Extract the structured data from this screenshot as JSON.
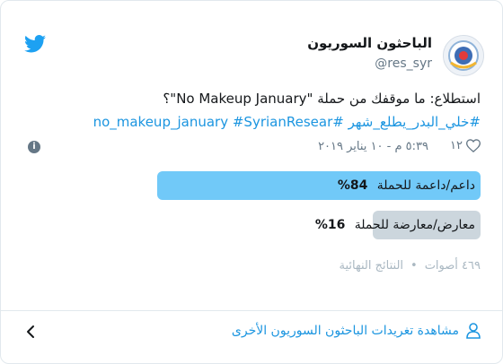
{
  "tweet": {
    "display_name": "الباحثون السوريون",
    "handle": "@res_syr",
    "text_line1": "استطلاع: ما موقفك من حملة \"No Makeup January\"؟",
    "hashtags": [
      "#خلي_البدر_يطلع_شهر",
      "#no_makeup_january",
      "#SyrianResear"
    ],
    "like_count": "١٢",
    "timestamp": "٥:٣٩ م - ١٠ يناير ٢٠١٩",
    "icons": {
      "logo": "twitter-bird-icon",
      "like": "heart-icon",
      "info": "info-icon",
      "avatar": "account-avatar"
    }
  },
  "poll": {
    "options": [
      {
        "label": "داعم/داعمة للحملة",
        "percent_text": "84%",
        "percent": 84,
        "color": "#71c9f8",
        "winner": true
      },
      {
        "label": "معارض/معارضة للحملة",
        "percent_text": "16%",
        "percent": 16,
        "color": "#ccd6dd",
        "winner": false
      }
    ],
    "votes": "٤٦٩ أصوات",
    "status": "النتائج النهائية"
  },
  "footer": {
    "link": "مشاهدة تغريدات الباحثون السوريون الأخرى",
    "icons": {
      "person": "person-icon",
      "chevron": "chevron-left-icon"
    }
  },
  "colors": {
    "accent": "#1b95e0",
    "logo": "#1da1f2",
    "muted": "#657786"
  }
}
